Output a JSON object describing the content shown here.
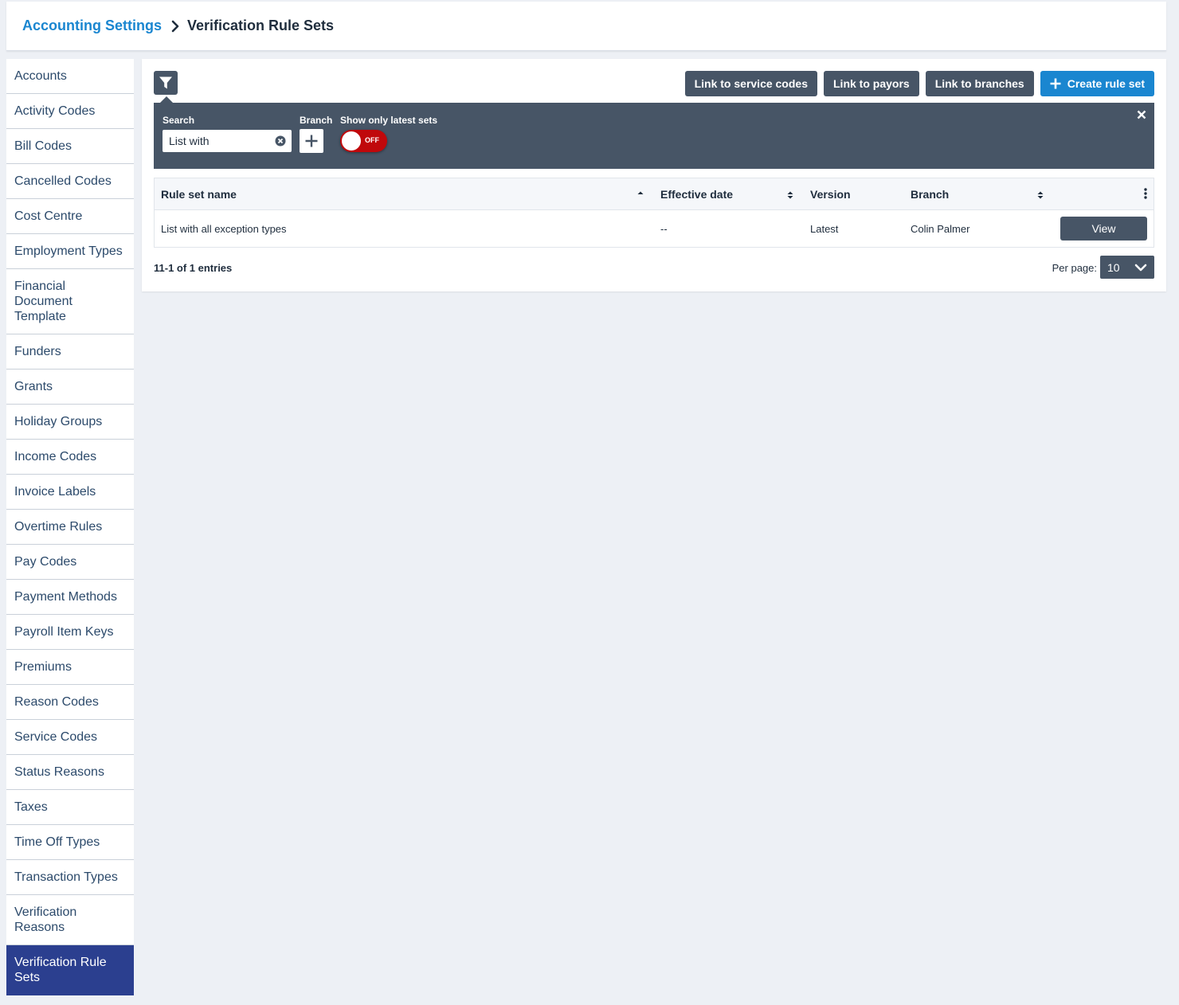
{
  "breadcrumb": {
    "parent": "Accounting Settings",
    "current": "Verification Rule Sets"
  },
  "sidebar": {
    "items": [
      {
        "label": "Accounts"
      },
      {
        "label": "Activity Codes"
      },
      {
        "label": "Bill Codes"
      },
      {
        "label": "Cancelled Codes"
      },
      {
        "label": "Cost Centre"
      },
      {
        "label": "Employment Types"
      },
      {
        "label": "Financial Document Template"
      },
      {
        "label": "Funders"
      },
      {
        "label": "Grants"
      },
      {
        "label": "Holiday Groups"
      },
      {
        "label": "Income Codes"
      },
      {
        "label": "Invoice Labels"
      },
      {
        "label": "Overtime Rules"
      },
      {
        "label": "Pay Codes"
      },
      {
        "label": "Payment Methods"
      },
      {
        "label": "Payroll Item Keys"
      },
      {
        "label": "Premiums"
      },
      {
        "label": "Reason Codes"
      },
      {
        "label": "Service Codes"
      },
      {
        "label": "Status Reasons"
      },
      {
        "label": "Taxes"
      },
      {
        "label": "Time Off Types"
      },
      {
        "label": "Transaction Types"
      },
      {
        "label": "Verification Reasons"
      },
      {
        "label": "Verification Rule Sets",
        "active": true
      }
    ]
  },
  "toolbar": {
    "link_service_codes": "Link to service codes",
    "link_payors": "Link to payors",
    "link_branches": "Link to branches",
    "create_rule_set": "Create rule set"
  },
  "filters": {
    "search_label": "Search",
    "search_value": "List with",
    "branch_label": "Branch",
    "latest_label": "Show only latest sets",
    "toggle_state": "OFF"
  },
  "table": {
    "headers": {
      "name": "Rule set name",
      "effective_date": "Effective date",
      "version": "Version",
      "branch": "Branch"
    },
    "rows": [
      {
        "name": "List with all exception types",
        "effective_date": "--",
        "version": "Latest",
        "branch": "Colin Palmer",
        "action": "View"
      }
    ]
  },
  "pagination": {
    "entries": "11-1 of 1 entries",
    "per_page_label": "Per page:",
    "per_page_value": "10"
  },
  "colors": {
    "accent": "#1a86d0",
    "dark_button": "#475566",
    "active_nav": "#2b3f8f",
    "toggle_off": "#c0080b"
  }
}
